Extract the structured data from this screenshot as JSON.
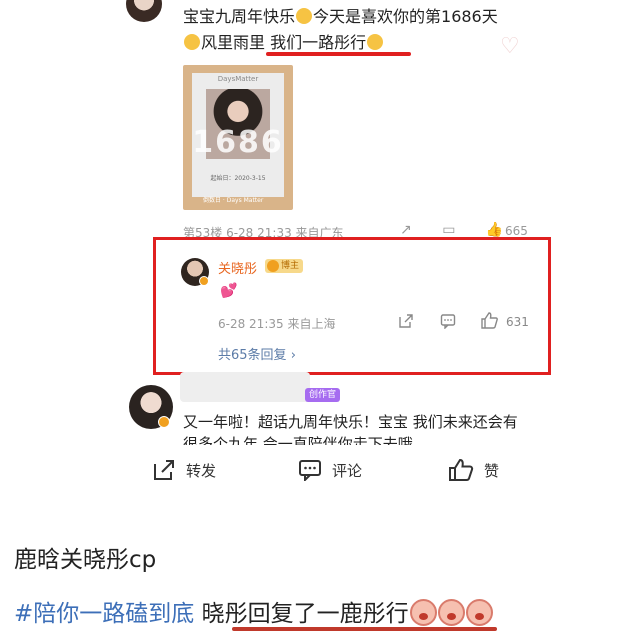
{
  "top_comment": {
    "line1": "宝宝九周年快乐",
    "line1b": "今天是喜欢你的第1686天",
    "line2a": "风里雨里",
    "line2b": "我们一路彤行",
    "photo": {
      "brand": "DaysMatter",
      "number": "1686",
      "date": "起始日：2020-3-15",
      "footer": "倒数日 · Days Matter"
    },
    "meta": "第53楼  6-28 21:33  来自广东",
    "like_count": "665"
  },
  "reply": {
    "name": "关晓彤",
    "badge": "博主",
    "emoji": "💕",
    "meta": "6-28 21:35  来自上海",
    "like_count": "631",
    "more_replies": "共65条回复",
    "more_chevron": "›"
  },
  "second_comment": {
    "badge": "创作官",
    "text": "又一年啦！超话九周年快乐！宝宝 我们未来还会有很多个九年 会一直陪伴你走下去哦"
  },
  "action_bar": {
    "share": "转发",
    "comment": "评论",
    "like": "赞"
  },
  "caption": {
    "line1": "鹿晗关晓彤cp",
    "hashtag": "#陪你一路磕到底",
    "line2": "晓彤回复了一鹿彤行"
  },
  "colors": {
    "highlight_red": "#e02020",
    "link_blue": "#5b7ba7",
    "hashtag_blue": "#3d6fb8",
    "name_orange": "#e86722"
  }
}
